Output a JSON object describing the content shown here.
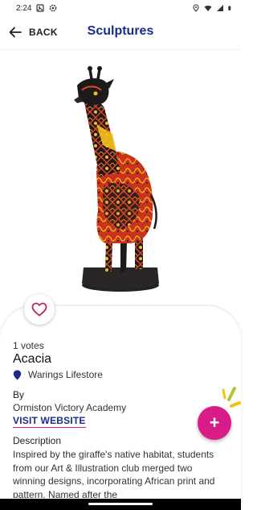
{
  "status_bar": {
    "time": "2:24",
    "icons": [
      "photo-icon",
      "settings-icon",
      "location-icon",
      "wifi-icon",
      "signal-icon",
      "battery-icon"
    ]
  },
  "app_bar": {
    "back_label": "BACK",
    "title": "Sculptures"
  },
  "sculpture": {
    "votes": "1 votes",
    "name": "Acacia",
    "location": "Warings Lifestore",
    "by_label": "By",
    "by_name": "Ormiston Victory Academy",
    "visit_label": "VISIT WEBSITE",
    "description_label": "Description",
    "description": "Inspired by the giraffe's native habitat, students from our Art & Illustration club merged two winning designs, incorporating African print and pattern. Named after the"
  },
  "colors": {
    "primary": "#1c2a8a",
    "accent": "#d81b87"
  }
}
